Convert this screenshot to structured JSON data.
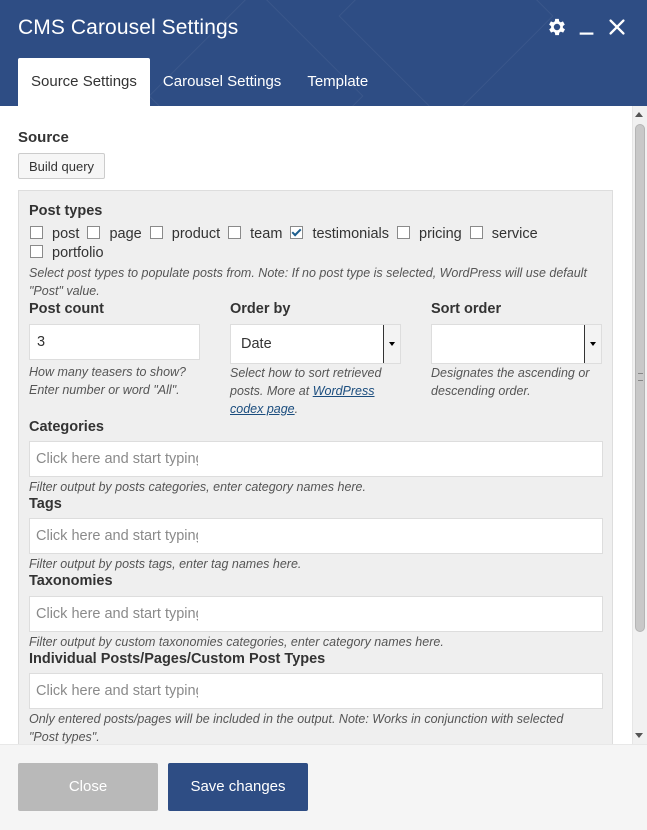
{
  "header": {
    "title": "CMS Carousel Settings",
    "colors": {
      "header_bg": "#2e4d84",
      "primary_button": "#2e4d84"
    },
    "icons": [
      "gear-icon",
      "minimize-icon",
      "close-icon"
    ]
  },
  "tabs": [
    {
      "label": "Source Settings",
      "active": true
    },
    {
      "label": "Carousel Settings",
      "active": false
    },
    {
      "label": "Template",
      "active": false
    }
  ],
  "source": {
    "label": "Source",
    "build_query_label": "Build query"
  },
  "post_types": {
    "label": "Post types",
    "options": [
      {
        "label": "post",
        "checked": false
      },
      {
        "label": "page",
        "checked": false
      },
      {
        "label": "product",
        "checked": false
      },
      {
        "label": "team",
        "checked": false
      },
      {
        "label": "testimonials",
        "checked": true
      },
      {
        "label": "pricing",
        "checked": false
      },
      {
        "label": "service",
        "checked": false
      },
      {
        "label": "portfolio",
        "checked": false
      }
    ],
    "help": "Select post types to populate posts from. Note: If no post type is selected, WordPress will use default \"Post\" value."
  },
  "post_count": {
    "label": "Post count",
    "value": "3",
    "help": "How many teasers to show? Enter number or word \"All\"."
  },
  "order_by": {
    "label": "Order by",
    "value": "Date",
    "help_prefix": "Select how to sort retrieved posts. More at ",
    "help_link": "WordPress codex page",
    "help_suffix": "."
  },
  "sort_order": {
    "label": "Sort order",
    "value": "",
    "help": "Designates the ascending or descending order."
  },
  "categories": {
    "label": "Categories",
    "placeholder": "Click here and start typing...",
    "help": "Filter output by posts categories, enter category names here."
  },
  "tags": {
    "label": "Tags",
    "placeholder": "Click here and start typing...",
    "help": "Filter output by posts tags, enter tag names here."
  },
  "taxonomies": {
    "label": "Taxonomies",
    "placeholder": "Click here and start typing...",
    "help": "Filter output by custom taxonomies categories, enter category names here."
  },
  "individual": {
    "label": "Individual Posts/Pages/Custom Post Types",
    "placeholder": "Click here and start typing...",
    "help": "Only entered posts/pages will be included in the output. Note: Works in conjunction with selected \"Post types\"."
  },
  "footer": {
    "close_label": "Close",
    "save_label": "Save changes"
  }
}
